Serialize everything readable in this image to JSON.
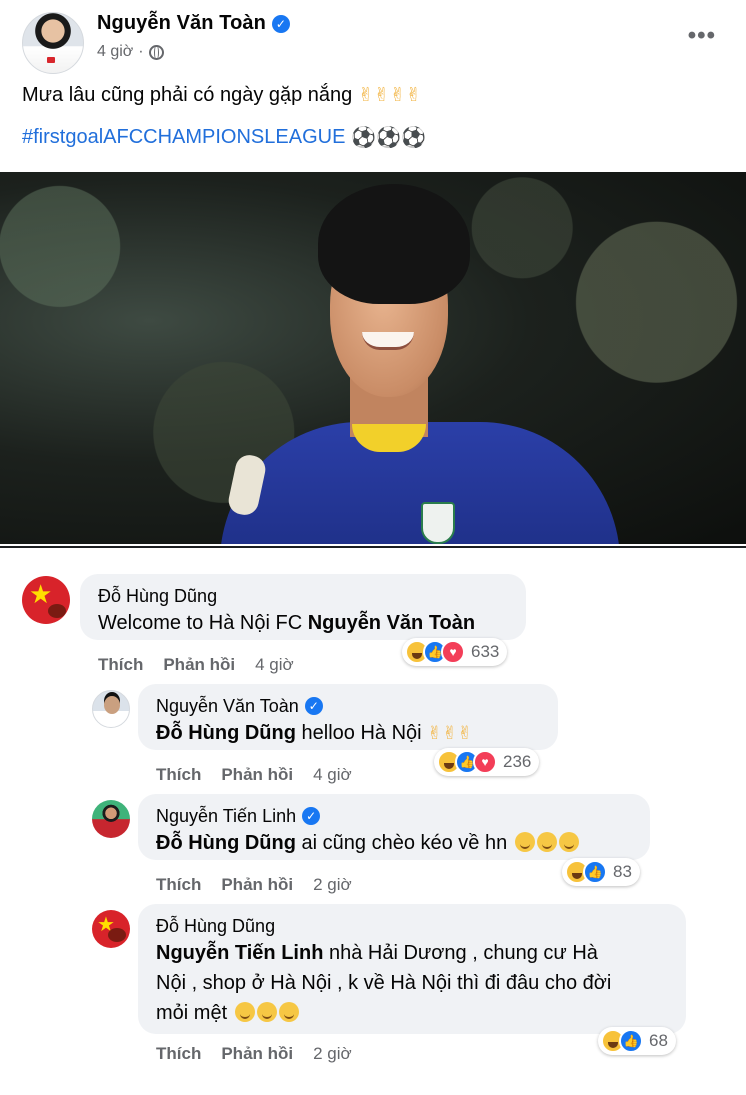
{
  "post": {
    "author": "Nguyễn Văn Toàn",
    "time": "4 giờ",
    "text": "Mưa lâu cũng phải có ngày gặp nắng",
    "text_emojis": "✌✌✌✌",
    "hashtag": "#firstgoalAFCCHAMPIONSLEAGUE",
    "hashtag_emojis": "⚽⚽⚽",
    "more_label": "•••"
  },
  "comments": [
    {
      "author": "Đỗ Hùng Dũng",
      "verified": false,
      "mention": "",
      "text": "Welcome to Hà Nội FC ",
      "text_mention_after": "Nguyễn Văn Toàn",
      "like_label": "Thích",
      "reply_label": "Phản hồi",
      "time": "4 giờ",
      "reactions": [
        "haha",
        "like",
        "love"
      ],
      "reaction_count": "633"
    },
    {
      "author": "Nguyễn Văn Toàn",
      "verified": true,
      "mention": "Đỗ Hùng Dũng",
      "text": " helloo Hà Nội ",
      "emojis": "✌✌✌",
      "like_label": "Thích",
      "reply_label": "Phản hồi",
      "time": "4 giờ",
      "reactions": [
        "haha",
        "like",
        "love"
      ],
      "reaction_count": "236"
    },
    {
      "author": "Nguyễn Tiến Linh",
      "verified": true,
      "mention": "Đỗ Hùng Dũng",
      "text": " ai cũng chèo kéo về hn ",
      "like_label": "Thích",
      "reply_label": "Phản hồi",
      "time": "2 giờ",
      "reactions": [
        "haha",
        "like"
      ],
      "reaction_count": "83"
    },
    {
      "author": "Đỗ Hùng Dũng",
      "verified": false,
      "mention": "Nguyễn Tiến Linh",
      "text_line1": " nhà Hải Dương , chung cư Hà",
      "text_line2": "Nội , shop ở Hà Nội , k về Hà Nội thì đi đâu cho đời",
      "text_line3": "mỏi mệt ",
      "like_label": "Thích",
      "reply_label": "Phản hồi",
      "time": "2 giờ",
      "reactions": [
        "haha",
        "like"
      ],
      "reaction_count": "68"
    }
  ],
  "colors": {
    "link": "#216fdb",
    "verified": "#1877f2",
    "bubble": "#f0f2f5",
    "secondary_text": "#65676b"
  }
}
